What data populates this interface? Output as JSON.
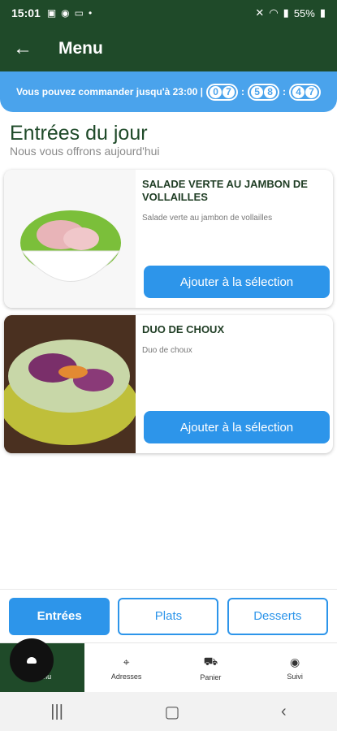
{
  "status_bar": {
    "time": "15:01",
    "battery": "55%"
  },
  "app_bar": {
    "title": "Menu"
  },
  "banner": {
    "text": "Vous pouvez commander jusqu'à 23:00 |",
    "timer": {
      "h1": "0",
      "h2": "7",
      "m1": "5",
      "m2": "8",
      "s1": "4",
      "s2": "7"
    }
  },
  "section": {
    "title": "Entrées du jour",
    "subtitle": "Nous vous offrons aujourd'hui"
  },
  "items": [
    {
      "name": "SALADE VERTE AU JAMBON DE VOLLAILLES",
      "description": "Salade verte au jambon de vollailles",
      "button": "Ajouter à la sélection"
    },
    {
      "name": "DUO DE CHOUX",
      "description": "Duo de choux",
      "button": "Ajouter à la sélection"
    }
  ],
  "tabs": [
    {
      "label": "Entrées",
      "active": true
    },
    {
      "label": "Plats",
      "active": false
    },
    {
      "label": "Desserts",
      "active": false
    }
  ],
  "bottom_nav": [
    {
      "label": "Menu",
      "icon": "menu-icon"
    },
    {
      "label": "Adresses",
      "icon": "location-pin-icon"
    },
    {
      "label": "Panier",
      "icon": "cart-icon"
    },
    {
      "label": "Suivi",
      "icon": "eye-icon"
    }
  ],
  "colors": {
    "primary_green": "#1f4a29",
    "accent_blue": "#2d95ea",
    "banner_blue": "#4aa3ec"
  }
}
